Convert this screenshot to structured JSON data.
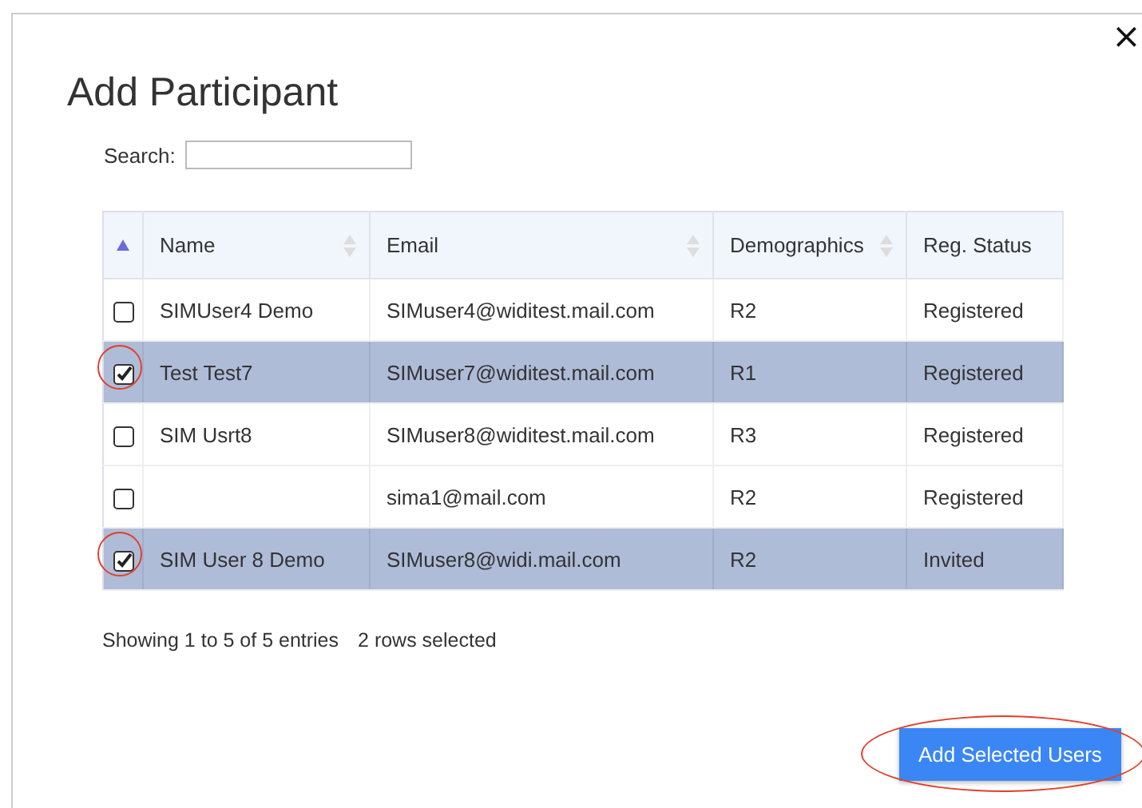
{
  "dialog": {
    "title": "Add Participant",
    "close": "×"
  },
  "search": {
    "label": "Search:"
  },
  "table": {
    "select_column": {
      "sorted": true
    },
    "columns": [
      {
        "label": "Name",
        "sortable": true
      },
      {
        "label": "Email",
        "sortable": true
      },
      {
        "label": "Demographics",
        "sortable": true
      },
      {
        "label": "Reg. Status",
        "sortable": false
      }
    ],
    "rows": [
      {
        "selected": false,
        "checked": false,
        "annotated": false,
        "cells": [
          "SIMUser4 Demo",
          "SIMuser4@widitest.mail.com",
          "R2",
          "Registered"
        ]
      },
      {
        "selected": true,
        "checked": true,
        "annotated": true,
        "cells": [
          "Test Test7",
          "SIMuser7@widitest.mail.com",
          "R1",
          "Registered"
        ]
      },
      {
        "selected": false,
        "checked": false,
        "annotated": false,
        "cells": [
          "SIM Usrt8",
          "SIMuser8@widitest.mail.com",
          "R3",
          "Registered"
        ]
      },
      {
        "selected": false,
        "checked": false,
        "annotated": false,
        "cells": [
          "",
          "sima1@mail.com",
          "R2",
          "Registered"
        ]
      },
      {
        "selected": true,
        "checked": true,
        "annotated": true,
        "cells": [
          "SIM User 8 Demo",
          "SIMuser8@widi.mail.com",
          "R2",
          "Invited"
        ]
      }
    ]
  },
  "info": [
    "Showing 1 to 5 of 5 entries",
    "2 rows selected"
  ],
  "button": {
    "label": "Add Selected Users",
    "annotated": true
  }
}
